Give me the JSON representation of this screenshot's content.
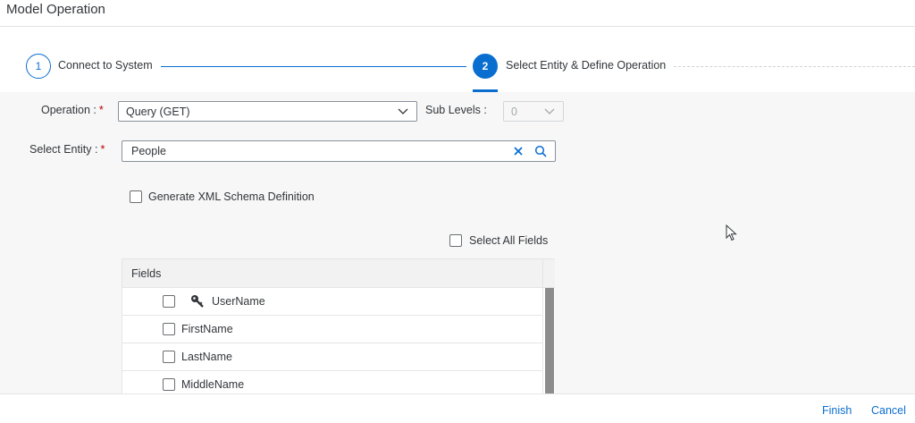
{
  "window": {
    "title": "Model Operation"
  },
  "wizard": {
    "steps": [
      {
        "number": "1",
        "label": "Connect to System"
      },
      {
        "number": "2",
        "label": "Select Entity & Define Operation"
      }
    ],
    "accent_color": "#0a6ed1"
  },
  "form": {
    "operation": {
      "label": "Operation :",
      "required_mark": "*",
      "value": "Query (GET)"
    },
    "sub_levels": {
      "label": "Sub Levels :",
      "value": "0"
    },
    "entity": {
      "label": "Select Entity :",
      "required_mark": "*",
      "value": "People"
    },
    "generate_xsd": {
      "label": "Generate XML Schema Definition",
      "checked": false
    },
    "select_all": {
      "label": "Select All Fields",
      "checked": false
    }
  },
  "fields_table": {
    "header": "Fields",
    "rows": [
      {
        "name": "UserName",
        "icon": "key-icon"
      },
      {
        "name": "FirstName"
      },
      {
        "name": "LastName"
      },
      {
        "name": "MiddleName"
      }
    ]
  },
  "footer": {
    "finish_label": "Finish",
    "cancel_label": "Cancel"
  }
}
